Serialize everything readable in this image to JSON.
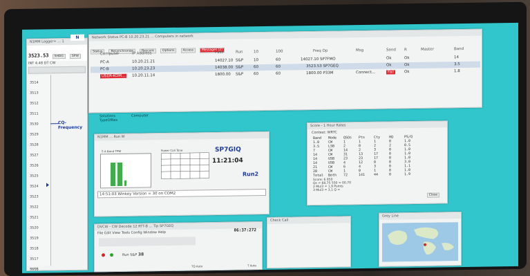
{
  "main_window": {
    "title": "N1MM Logger+ ... 1",
    "freq_display": "3523.53",
    "buttons": [
      "SHDG",
      "SPW"
    ],
    "status": [
      "INT",
      "4.48",
      "DT",
      "CW"
    ],
    "cq_frequency_label": "CQ-Frequency",
    "scale": [
      "3514",
      "3513",
      "3512",
      "3511",
      "3530",
      "3529",
      "3528",
      "3527",
      "3526",
      "3525",
      "3524",
      "3523",
      "3522",
      "3521",
      "3520",
      "3519",
      "3518",
      "3517",
      "3516",
      "3515"
    ],
    "bottom_label": "N1MM"
  },
  "network_status": {
    "title": "Network Status PC-B 10.20.23.21 ... Computers in network",
    "tabs": [
      "Status",
      "Resynchronize",
      "Rescore",
      "Options",
      "Access",
      "Messages (2)"
    ],
    "columns": [
      "Computer",
      "IP Address",
      "Pass",
      "Run",
      "10",
      "100",
      "Freq Op",
      "Msg",
      "Send",
      "R",
      "Master",
      "Band"
    ],
    "rows": [
      {
        "computer": "PC-A",
        "ip": "10.20.21.21",
        "pass": "14027.10",
        "run": "S&P",
        "c10": "10",
        "c100": "60",
        "freq_op": "14027.10 SP7FMO",
        "msg": "",
        "send": "Ok",
        "r": "Ok",
        "band": "14",
        "selected": false,
        "alert": false
      },
      {
        "computer": "PC-B",
        "ip": "10.20.23.23",
        "pass": "14038.00",
        "run": "S&P",
        "c10": "60",
        "c100": "60",
        "freq_op": "3523.53 SP7GEQ",
        "msg": "",
        "send": "Ok",
        "r": "Ok",
        "band": "3.5",
        "selected": true,
        "alert": false
      },
      {
        "computer": "USER-KOM...",
        "ip": "10.20.11.14",
        "pass": "1800.00",
        "run": "S&P",
        "c10": "60",
        "c100": "60",
        "freq_op": "1800.00 P33M",
        "msg": "Connect...",
        "send": "Fail",
        "r": "Ok",
        "band": "1.8",
        "selected": false,
        "alert": true
      }
    ]
  },
  "desktop_labels": [
    "Solutions",
    "Computer",
    "TypeOfRes"
  ],
  "entry_window": {
    "title": "N1MM ... Run W",
    "callsign": "SP7GIQ",
    "time": "11:21:04",
    "mode_label": "Run2",
    "status_line": "14:51:03 Winkey Version = 30 on COM2",
    "grid_labels": [
      "S",
      "A",
      "Band",
      "TPW",
      "Power",
      "Call",
      "Tone"
    ]
  },
  "score_window": {
    "title": "Score - 1 Hour Rates",
    "contest": "Contest: WRTC",
    "headers": [
      "Band",
      "Mode",
      "QSOs",
      "Pts",
      "Cty",
      "HQ",
      "PS/Q"
    ],
    "rows": [
      [
        "1.8",
        "CW",
        "1",
        "1",
        "1",
        "0",
        "1.0"
      ],
      [
        "3.5",
        "LSB",
        "2",
        "0",
        "2",
        "2",
        "0.5"
      ],
      [
        "7",
        "CW",
        "14",
        "2",
        "3",
        "0",
        "1.0"
      ],
      [
        "14",
        "CW",
        "31",
        "13",
        "17",
        "0",
        "1.0"
      ],
      [
        "14",
        "USB",
        "23",
        "23",
        "17",
        "0",
        "1.0"
      ],
      [
        "14",
        "USB",
        "4",
        "12",
        "0",
        "0",
        "3.0"
      ],
      [
        "21",
        "CW",
        "6",
        "4",
        "3",
        "0",
        "1.1"
      ],
      [
        "28",
        "CW",
        "1",
        "0",
        "1",
        "0",
        "1.0"
      ],
      [
        "Total",
        "Both",
        "72",
        "141",
        "44",
        "0",
        "1.9"
      ]
    ],
    "footer": [
      "Score: 6 850",
      "Qs = 68,75 550 = 00,70",
      "2 Mul3 = 1,9 Points",
      "3 Mul3 = 3,1 Q ="
    ],
    "close_button": "Close"
  },
  "bandmap_window": {
    "title": "DVCW - CW Decode 12 RTT-B ... Tip SP7GEQ",
    "menu": [
      "File",
      "Edit",
      "View",
      "Tools",
      "Config",
      "Window",
      "Help"
    ],
    "time_right": "06:37:272",
    "labels": [
      "Run",
      "S&P"
    ],
    "value": "38",
    "footer_left": "TQ Auto",
    "footer_right": "T Auto"
  },
  "check_window": {
    "title": "Check Call"
  },
  "map_window": {
    "title": "Grey Line"
  }
}
